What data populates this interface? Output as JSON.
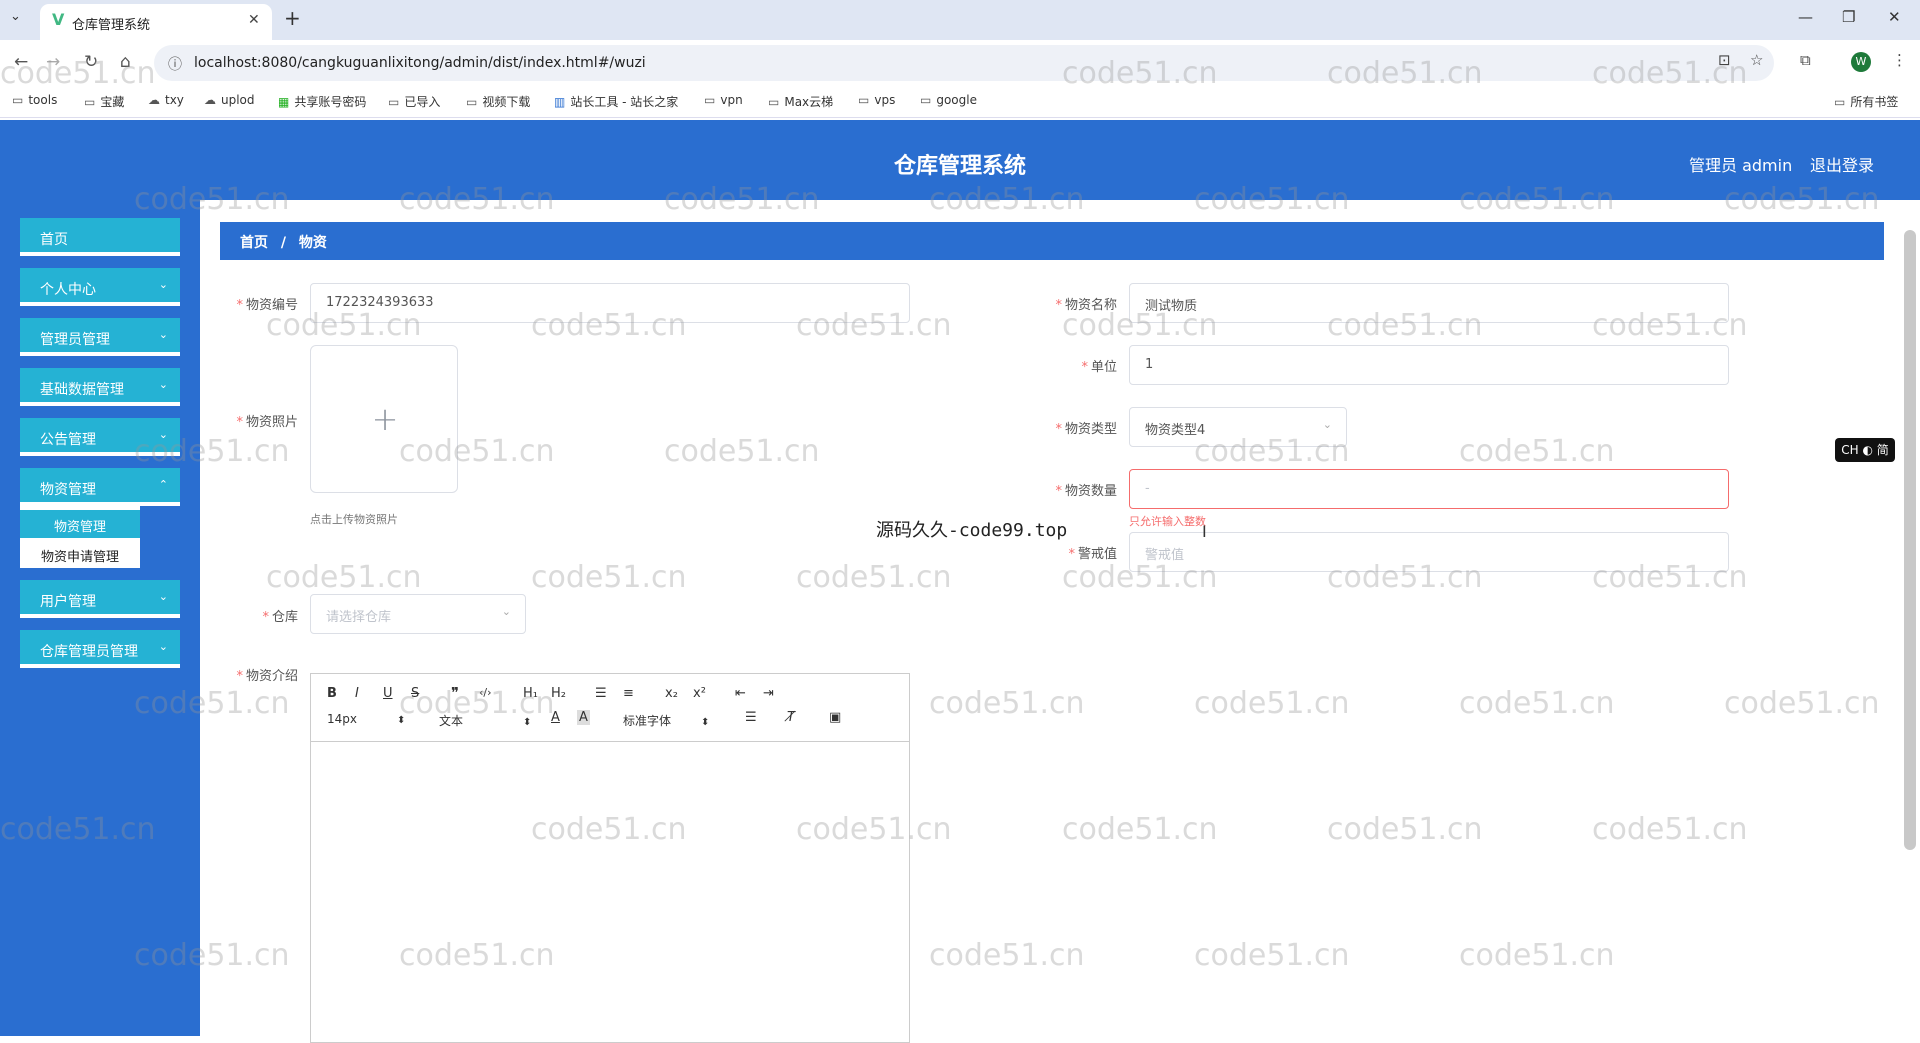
{
  "browser": {
    "tab_title": "仓库管理系统",
    "url": "localhost:8080/cangkuguanlixitong/admin/dist/index.html#/wuzi",
    "profile_initial": "W",
    "bookmarks": [
      "tools",
      "宝藏",
      "txy",
      "uplod",
      "共享账号密码",
      "已导入",
      "视频下载",
      "站长工具 - 站长之家",
      "vpn",
      "Max云梯",
      "vps",
      "google"
    ],
    "all_bookmarks": "所有书签"
  },
  "header": {
    "title": "仓库管理系统",
    "user": "管理员 admin",
    "logout": "退出登录"
  },
  "sidebar": {
    "items": [
      "首页",
      "个人中心",
      "管理员管理",
      "基础数据管理",
      "公告管理",
      "物资管理",
      "用户管理",
      "仓库管理员管理"
    ],
    "submenu": [
      "物资管理",
      "物资申请管理"
    ]
  },
  "breadcrumb": {
    "home": "首页",
    "sep": "/",
    "current": "物资"
  },
  "form": {
    "code_label": "物资编号",
    "code_value": "1722324393633",
    "name_label": "物资名称",
    "name_value": "测试物质",
    "unit_label": "单位",
    "unit_value": "1",
    "photo_label": "物资照片",
    "photo_hint": "点击上传物资照片",
    "type_label": "物资类型",
    "type_value": "物资类型4",
    "qty_label": "物资数量",
    "qty_value": "-",
    "qty_error": "只允许输入整数",
    "warn_label": "警戒值",
    "warn_placeholder": "警戒值",
    "warehouse_label": "仓库",
    "warehouse_placeholder": "请选择仓库",
    "intro_label": "物资介绍"
  },
  "editor": {
    "row1": [
      "B",
      "I",
      "U",
      "S",
      "❞",
      "‹/›",
      "H₁",
      "H₂",
      "☰",
      "≡",
      "x₂",
      "x²",
      "⇤",
      "⇥"
    ],
    "font_size": "14px",
    "text_type": "文本",
    "font_family": "标准字体"
  },
  "watermark": "code51.cn",
  "overlay_text": "源码久久-code99.top",
  "ime": "CH ◐ 简"
}
